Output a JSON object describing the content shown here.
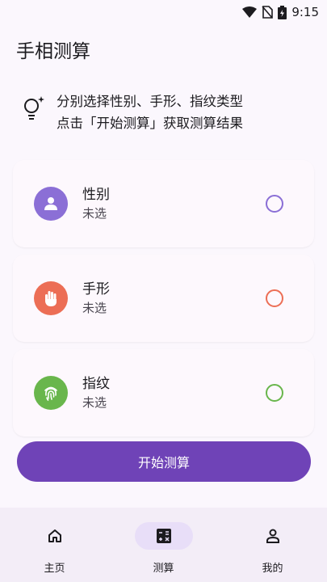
{
  "status_bar": {
    "time": "9:15",
    "icons": [
      "wifi-icon",
      "no-sim-icon",
      "battery-charging-icon"
    ]
  },
  "app_title": "手相测算",
  "hint": {
    "icon": "lightbulb-icon",
    "line1": "分别选择性别、手形、指纹类型",
    "line2": "点击「开始测算」获取测算结果"
  },
  "cards": [
    {
      "name": "性别",
      "status": "未选",
      "icon": "person-icon",
      "color": "#8b6fd6"
    },
    {
      "name": "手形",
      "status": "未选",
      "icon": "hand-icon",
      "color": "#ec6e55"
    },
    {
      "name": "指纹",
      "status": "未选",
      "icon": "fingerprint-icon",
      "color": "#69b64c"
    }
  ],
  "start_button": "开始测算",
  "bottom_nav": {
    "active": "测算",
    "items": [
      {
        "label": "主页",
        "icon": "home-icon"
      },
      {
        "label": "测算",
        "icon": "calculator-icon"
      },
      {
        "label": "我的",
        "icon": "person-outline-icon"
      }
    ]
  },
  "colors": {
    "accent": "#6f43b7",
    "nav_active": "#e8def8",
    "background": "#fbf7fd"
  }
}
